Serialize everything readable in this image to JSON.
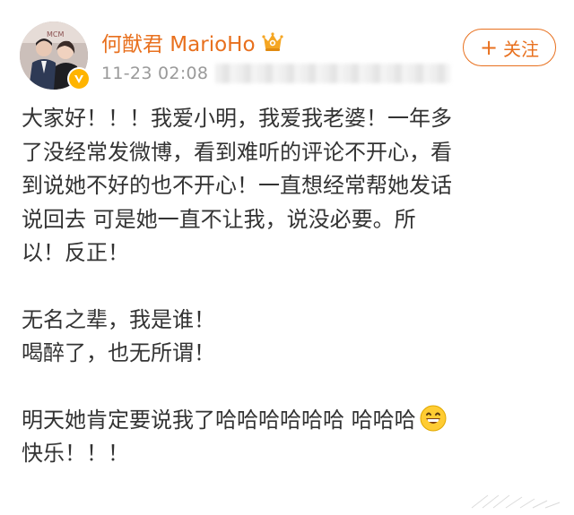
{
  "header": {
    "username": "何猷君 MarioHo",
    "timestamp": "11-23 02:08",
    "follow_label": "关注",
    "follow_plus": "+"
  },
  "icons": {
    "avatar": "avatar-photo",
    "verified": "verified-badge-icon",
    "vip": "vip-crown-icon",
    "emoji": "grinning-face-emoji"
  },
  "colors": {
    "username": "#e8701e",
    "follow_border": "#e8701e",
    "timestamp": "#9a9a9a",
    "body_text": "#333333",
    "verified": "#ffb400"
  },
  "post": {
    "paragraph1": [
      "大家好！！！我爱小明，我爱我老婆！一年多",
      "了没经常发微博，看到难听的评论不开心，看",
      "到说她不好的也不开心！一直想经常帮她发话",
      "说回去 可是她一直不让我，说没必要。所",
      "以！反正！"
    ],
    "paragraph2": [
      "无名之辈，我是谁！",
      "喝醉了，也无所谓！"
    ],
    "paragraph3": [
      "明天她肯定要说我了哈哈哈哈哈哈 哈哈哈",
      "快乐！！！"
    ]
  }
}
